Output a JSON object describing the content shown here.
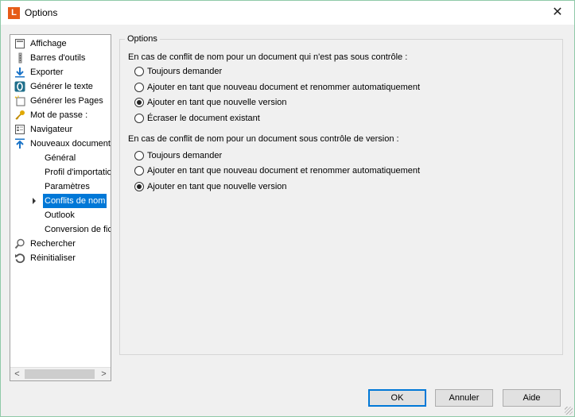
{
  "window": {
    "title": "Options",
    "app_icon_letter": "L",
    "close_glyph": "✕"
  },
  "tree": {
    "items": [
      {
        "label": "Affichage",
        "icon": "display-icon"
      },
      {
        "label": "Barres d'outils",
        "icon": "toolbar-icon"
      },
      {
        "label": "Exporter",
        "icon": "export-arrow-icon"
      },
      {
        "label": "Générer le texte",
        "icon": "ocr-icon"
      },
      {
        "label": "Générer les Pages",
        "icon": "generate-pages-icon"
      },
      {
        "label": "Mot de passe :",
        "icon": "key-icon"
      },
      {
        "label": "Navigateur",
        "icon": "navigator-icon"
      },
      {
        "label": "Nouveaux documents",
        "icon": "import-arrow-icon"
      },
      {
        "label": "Général",
        "sub": true
      },
      {
        "label": "Profil d'importatio",
        "sub": true
      },
      {
        "label": "Paramètres",
        "sub": true
      },
      {
        "label": "Conflits de nom",
        "sub": true,
        "selected": true
      },
      {
        "label": "Outlook",
        "sub": true
      },
      {
        "label": "Conversion de fic",
        "sub": true
      },
      {
        "label": "Rechercher",
        "icon": "search-icon"
      },
      {
        "label": "Réinitialiser",
        "icon": "reset-icon"
      }
    ],
    "scroll_left": "<",
    "scroll_right": ">"
  },
  "options": {
    "group_title": "Options",
    "q1": "En cas de conflit de nom pour un document qui n'est pas sous contrôle :",
    "q1_options": [
      {
        "label": "Toujours demander",
        "checked": false
      },
      {
        "label": "Ajouter en tant que nouveau document et renommer automatiquement",
        "checked": false
      },
      {
        "label": "Ajouter en tant que nouvelle version",
        "checked": true
      },
      {
        "label": "Écraser le document existant",
        "checked": false
      }
    ],
    "q2": "En cas de conflit de nom pour un document sous contrôle de version :",
    "q2_options": [
      {
        "label": "Toujours demander",
        "checked": false
      },
      {
        "label": "Ajouter en tant que nouveau document et renommer automatiquement",
        "checked": false
      },
      {
        "label": "Ajouter en tant que nouvelle version",
        "checked": true
      }
    ]
  },
  "buttons": {
    "ok": "OK",
    "cancel": "Annuler",
    "help": "Aide"
  },
  "colors": {
    "selection": "#0078d7",
    "app_icon": "#e65b17"
  }
}
